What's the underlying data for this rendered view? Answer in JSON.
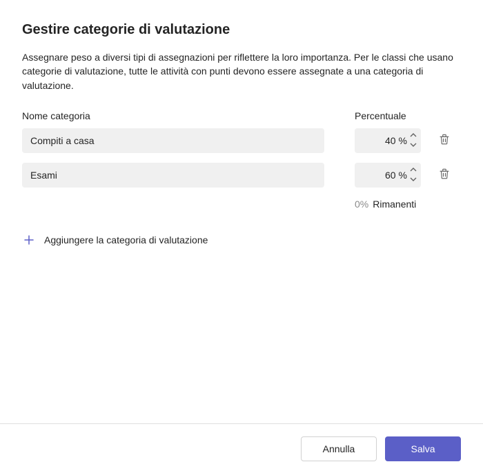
{
  "title": "Gestire categorie di valutazione",
  "description": "Assegnare peso a diversi tipi di assegnazioni per riflettere la loro importanza. Per le classi che usano categorie di valutazione, tutte le attività con punti devono essere assegnate a una categoria di valutazione.",
  "headers": {
    "name": "Nome categoria",
    "pct": "Percentuale"
  },
  "rows": [
    {
      "name": "Compiti a casa",
      "pct": "40"
    },
    {
      "name": "Esami",
      "pct": "60"
    }
  ],
  "pct_suffix": " %",
  "remaining": {
    "pct": "0%",
    "label": "Rimanenti"
  },
  "add_label": "Aggiungere la categoria di valutazione",
  "footer": {
    "cancel": "Annulla",
    "save": "Salva"
  },
  "colors": {
    "accent": "#5b5fc7"
  }
}
